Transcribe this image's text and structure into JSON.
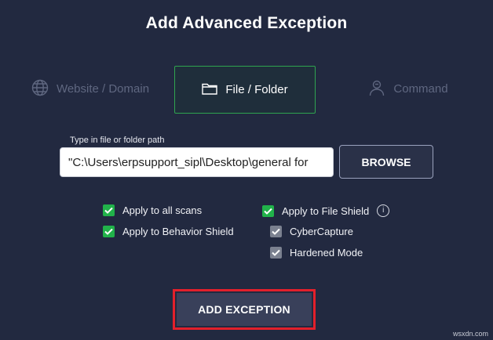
{
  "dialog": {
    "title": "Add Advanced Exception"
  },
  "tabs": [
    {
      "label": "Website / Domain",
      "icon": "globe-icon",
      "selected": false
    },
    {
      "label": "File / Folder",
      "icon": "folder-icon",
      "selected": true
    },
    {
      "label": "Command",
      "icon": "command-user-icon",
      "selected": false
    }
  ],
  "path": {
    "label": "Type in file or folder path",
    "value": "\"C:\\Users\\erpsupport_sipl\\Desktop\\general for"
  },
  "browse_label": "BROWSE",
  "checkboxes": {
    "apply_all_scans": {
      "label": "Apply to all scans",
      "checked": true
    },
    "apply_behavior_shield": {
      "label": "Apply to Behavior Shield",
      "checked": true
    },
    "apply_file_shield": {
      "label": "Apply to File Shield",
      "checked": true
    },
    "cybercapture": {
      "label": "CyberCapture",
      "checked": true
    },
    "hardened_mode": {
      "label": "Hardened Mode",
      "checked": true
    }
  },
  "add_exception_label": "ADD EXCEPTION",
  "watermark": "wsxdn.com",
  "colors": {
    "background": "#222940",
    "accent_green": "#21b24a",
    "highlight_red": "#e3202b"
  }
}
